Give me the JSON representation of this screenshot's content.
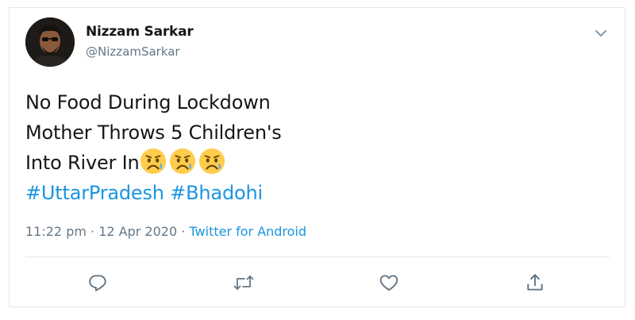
{
  "tweet": {
    "author_name": "Nizzam Sarkar",
    "author_handle": "@NizzamSarkar",
    "text_lines": [
      "No Food During Lockdown",
      "Mother Throws 5 Children's",
      "Into River In"
    ],
    "emojis": [
      "sad-but-relieved-face",
      "sad-but-relieved-face",
      "sad-but-relieved-face"
    ],
    "hashtags": [
      "#UttarPradesh",
      "#Bhadohi"
    ],
    "time": "11:22 pm",
    "separator": " · ",
    "date": "12 Apr 2020",
    "source": "Twitter for Android"
  },
  "actions": [
    {
      "name": "reply",
      "icon": "reply-icon"
    },
    {
      "name": "retweet",
      "icon": "retweet-icon"
    },
    {
      "name": "like",
      "icon": "heart-icon"
    },
    {
      "name": "share",
      "icon": "share-icon"
    }
  ],
  "colors": {
    "link": "#1b95e0",
    "secondary_text": "#657786",
    "primary_text": "#14171a",
    "border": "#e1e8ed",
    "emoji_face": "#ffcc4d",
    "emoji_tear": "#5dadec"
  }
}
